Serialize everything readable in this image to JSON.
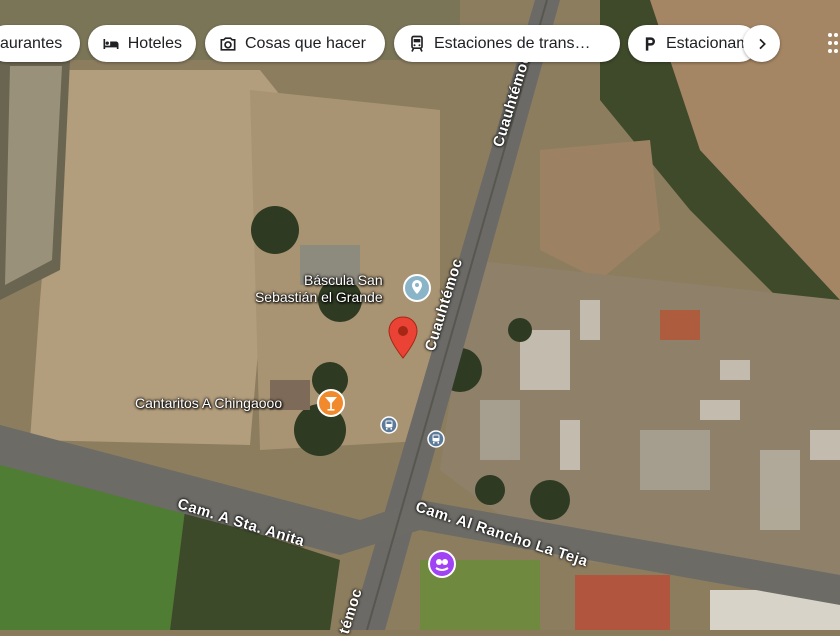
{
  "chips": [
    {
      "label": "aurantes",
      "icon": "restaurant-icon"
    },
    {
      "label": "Hoteles",
      "icon": "bed-icon"
    },
    {
      "label": "Cosas que hacer",
      "icon": "camera-icon"
    },
    {
      "label": "Estaciones de trans…",
      "icon": "train-icon"
    },
    {
      "label": "Estacionam",
      "icon": "parking-icon"
    }
  ],
  "places": {
    "bascula_line1": "Báscula San",
    "bascula_line2": "Sebastián el Grande",
    "cantaritos": "Cantaritos A Chingaooo"
  },
  "roads": {
    "cuauhtemoc_top": "Cuauhtémoc",
    "cuauhtemoc_mid": "Cuauhtémoc",
    "cuauhtemoc_bottom": "témoc",
    "sta_anita": "Cam. A Sta. Anita",
    "rancho_teja": "Cam. Al Rancho La Teja"
  },
  "colors": {
    "pin_red": "#EA4335",
    "place_gray": "#8AB4C8",
    "bar_orange": "#F08A2C",
    "purple_poi": "#A142F4",
    "transit_blue": "#5C7A99"
  }
}
